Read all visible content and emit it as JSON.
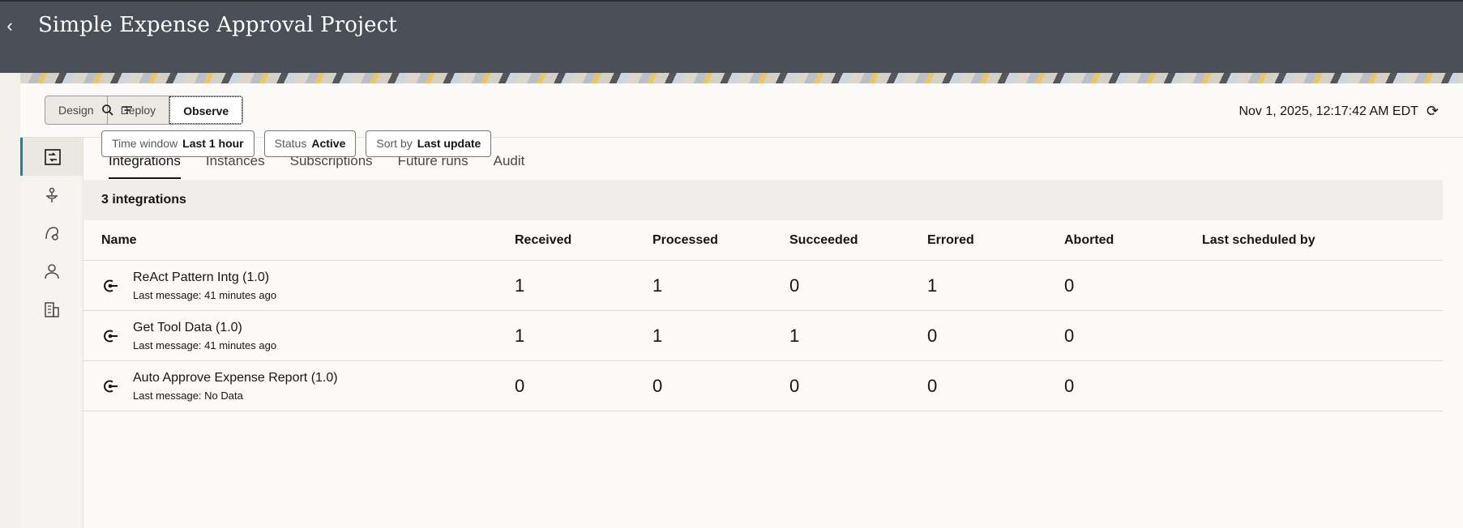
{
  "header": {
    "title": "Simple Expense Approval Project",
    "back_icon": "chevron-left-icon"
  },
  "mode_switch": {
    "options": [
      "Design",
      "Deploy",
      "Observe"
    ],
    "selected": "Observe"
  },
  "sidenav": {
    "icons": [
      "integrations-icon",
      "connections-icon",
      "agents-icon",
      "user-icon",
      "building-icon"
    ],
    "active": "integrations-icon"
  },
  "tabs": [
    "Integrations",
    "Instances",
    "Subscriptions",
    "Future runs",
    "Audit"
  ],
  "active_tab": "Integrations",
  "toolbar": {
    "search_icon": "search-icon",
    "filter_icon": "filter-icon"
  },
  "timestamp": "Nov 1, 2025, 12:17:42 AM EDT",
  "filters": [
    {
      "key": "Time window",
      "value": "Last 1 hour"
    },
    {
      "key": "Status",
      "value": "Active"
    },
    {
      "key": "Sort by",
      "value": "Last update"
    }
  ],
  "count_label": "3 integrations",
  "table": {
    "columns": [
      "Name",
      "Received",
      "Processed",
      "Succeeded",
      "Errored",
      "Aborted",
      "Last scheduled by"
    ],
    "rows": [
      {
        "name": "ReAct Pattern Intg (1.0)",
        "sub": "Last message: 41 minutes ago",
        "received": "1",
        "processed": "1",
        "succeeded": "0",
        "errored": "1",
        "aborted": "0",
        "last_scheduled_by": ""
      },
      {
        "name": "Get Tool Data (1.0)",
        "sub": "Last message: 41 minutes ago",
        "received": "1",
        "processed": "1",
        "succeeded": "1",
        "errored": "0",
        "aborted": "0",
        "last_scheduled_by": ""
      },
      {
        "name": "Auto Approve Expense Report (1.0)",
        "sub": "Last message: No Data",
        "received": "0",
        "processed": "0",
        "succeeded": "0",
        "errored": "0",
        "aborted": "0",
        "last_scheduled_by": ""
      }
    ]
  },
  "colors": {
    "header_bg": "#4a4e56",
    "accent": "#227e9e",
    "panel_bg": "#fbfaf9"
  }
}
